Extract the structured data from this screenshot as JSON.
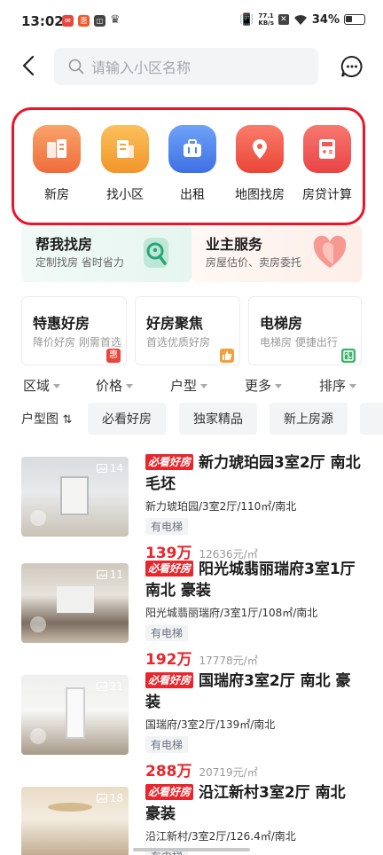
{
  "status_bar": {
    "time": "13:02",
    "network_speed": "77.1",
    "network_unit": "KB/s",
    "battery": "34%"
  },
  "header": {
    "search_placeholder": "请输入小区名称"
  },
  "quick_entries": [
    {
      "label": "新房",
      "icon": "new-house-icon",
      "color": "#f5844a"
    },
    {
      "label": "找小区",
      "icon": "building-icon",
      "color": "#f6a43c"
    },
    {
      "label": "出租",
      "icon": "suitcase-icon",
      "color": "#4b84ee"
    },
    {
      "label": "地图找房",
      "icon": "map-pin-icon",
      "color": "#f05a4a"
    },
    {
      "label": "房贷计算",
      "icon": "calculator-icon",
      "color": "#f0524e"
    }
  ],
  "banners": [
    {
      "title": "帮我找房",
      "subtitle": "定制找房 省时省力",
      "icon": "search-key-icon"
    },
    {
      "title": "业主服务",
      "subtitle": "房屋估价、卖房委托",
      "icon": "heart-house-icon"
    }
  ],
  "cards": [
    {
      "title": "特惠好房",
      "subtitle": "降价好房 刚需首选",
      "mark": "惠",
      "mark_color": "#e8463c"
    },
    {
      "title": "好房聚焦",
      "subtitle": "首选优质好房",
      "mark": "👍",
      "mark_color": "#f2a13a"
    },
    {
      "title": "电梯房",
      "subtitle": "电梯房 便捷出行",
      "mark": "▥",
      "mark_color": "#3db36b"
    }
  ],
  "filters": [
    "区域",
    "价格",
    "户型",
    "更多",
    "排序"
  ],
  "tag_row": {
    "lead": "户型图",
    "chips": [
      "必看好房",
      "独家精品",
      "新上房源"
    ]
  },
  "listings": [
    {
      "badge": "必看好房",
      "title": "新力琥珀园3室2厅 南北 毛坯",
      "desc": "新力琥珀园/3室2厅/110㎡/南北",
      "feature": "有电梯",
      "price": "139万",
      "unit_price": "12636元/㎡",
      "photo_count": "14"
    },
    {
      "badge": "必看好房",
      "title": "阳光城翡丽瑞府3室1厅 南北 豪装",
      "desc": "阳光城翡丽瑞府/3室1厅/108㎡/南北",
      "feature": "有电梯",
      "price": "192万",
      "unit_price": "17778元/㎡",
      "photo_count": "11"
    },
    {
      "badge": "必看好房",
      "title": "国瑞府3室2厅 南北 豪装",
      "desc": "国瑞府/3室2厅/139㎡/南北",
      "feature": "有电梯",
      "price": "288万",
      "unit_price": "20719元/㎡",
      "photo_count": "21"
    },
    {
      "badge": "必看好房",
      "title": "沿江新村3室2厅 南北 豪装",
      "desc": "沿江新村/3室2厅/126.4㎡/南北",
      "feature": "有电梯",
      "price": "",
      "unit_price": "",
      "photo_count": "18"
    }
  ]
}
